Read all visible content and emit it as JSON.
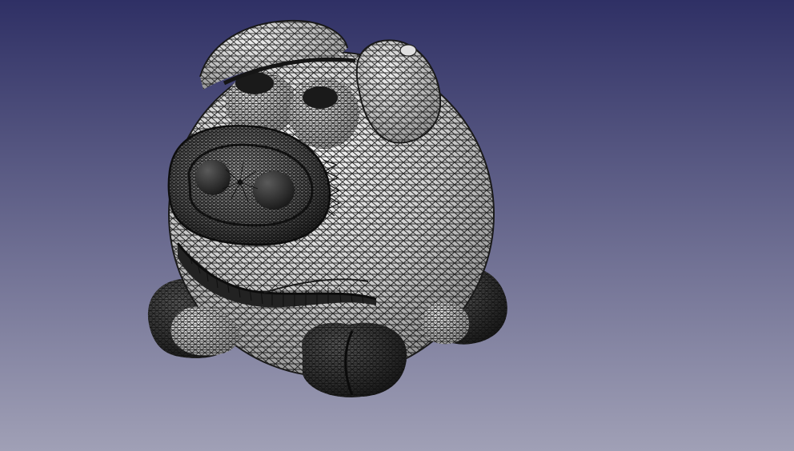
{
  "viewport": {
    "background_top": "#2f3065",
    "background_bottom": "#a0a0b6",
    "model": {
      "name": "",
      "render_mode": "wireframe-over-shaded",
      "surface_color": "#d6d6d6",
      "edge_color": "#151515"
    }
  }
}
